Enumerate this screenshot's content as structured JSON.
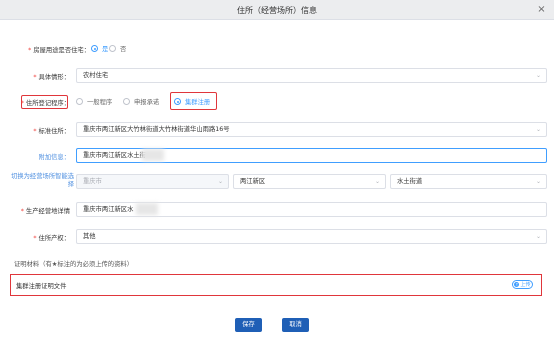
{
  "dialog": {
    "title": "住所（经营场所）信息",
    "close_glyph": "×"
  },
  "form": {
    "is_residential": {
      "label": "房屋用途是否住宅：",
      "options": [
        "是",
        "否"
      ],
      "selected": "是"
    },
    "situation": {
      "label": "具体情形：",
      "value": "农村住宅"
    },
    "registration": {
      "label": "住所登记程序：",
      "options": [
        "一般程序",
        "申报承诺",
        "集群注册"
      ],
      "selected": "集群注册"
    },
    "standard_address": {
      "label": "标准住所：",
      "value": "重庆市两江新区大竹林街道大竹林街道华山雨路16号"
    },
    "extra_info": {
      "label": "附加信息：",
      "value": "重庆市两江新区水土街"
    },
    "smart_select": {
      "label": "切换为经营场所智能选择",
      "city": "重庆市",
      "district": "两江新区",
      "street": "水土街道"
    },
    "production_address": {
      "label": "生产经营地详情",
      "value": "重庆市两江新区水"
    },
    "property": {
      "label": "住所产权：",
      "value": "其他"
    }
  },
  "proof": {
    "title": "证明材料（有★标注的为必须上传的资料）",
    "item": "集群注册证明文件",
    "upload_label": "上传"
  },
  "actions": {
    "save": "保存",
    "cancel": "取消"
  }
}
